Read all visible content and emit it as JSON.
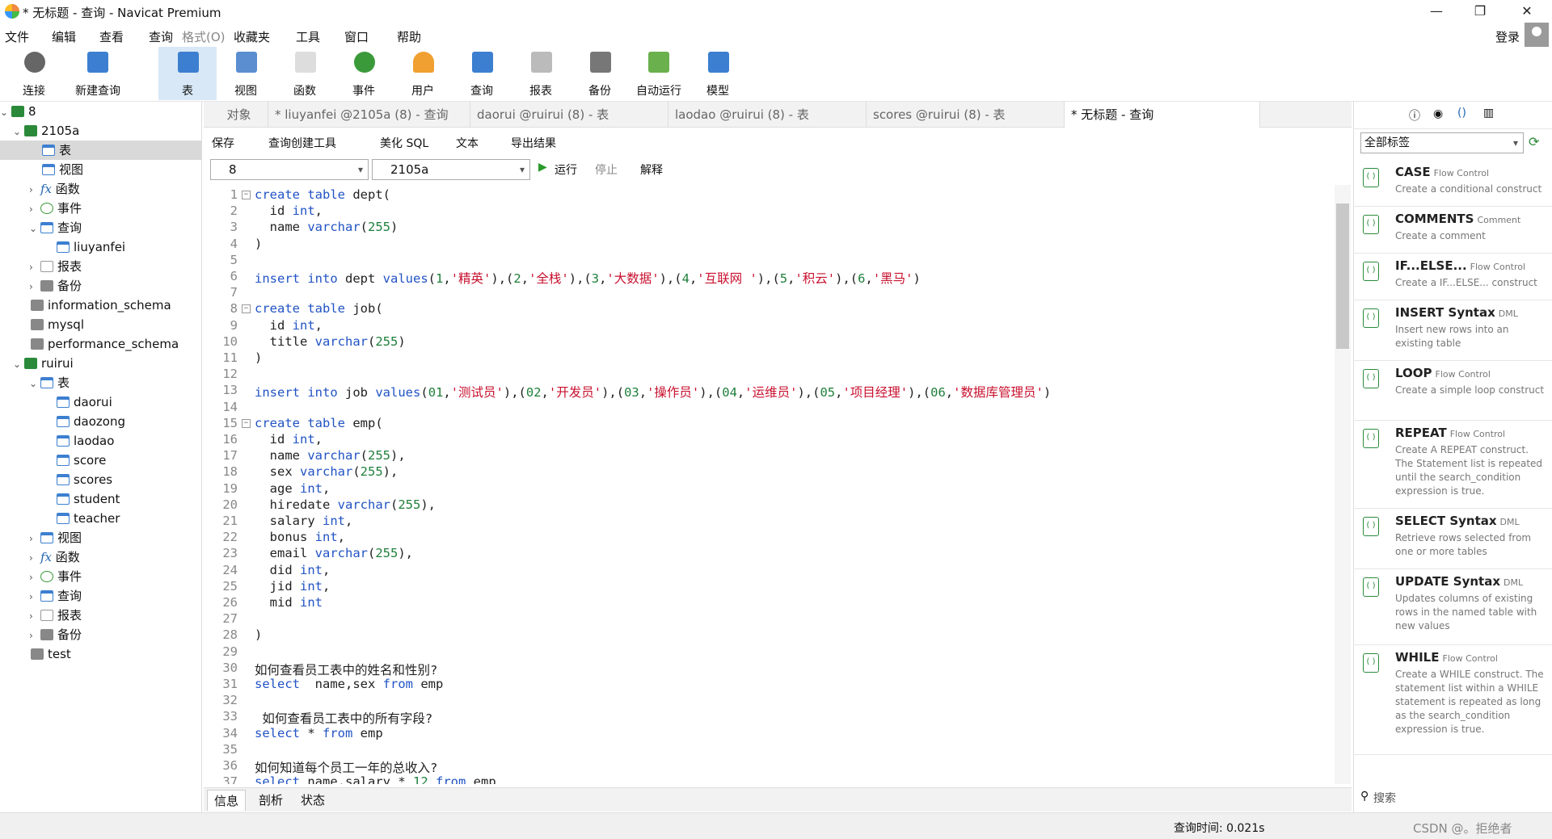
{
  "window": {
    "title": "* 无标题 - 查询 - Navicat Premium",
    "min": "—",
    "max": "❐",
    "close": "✕"
  },
  "menu": [
    "文件",
    "编辑",
    "查看",
    "查询",
    "格式(O)",
    "收藏夹",
    "工具",
    "窗口",
    "帮助"
  ],
  "login": "登录",
  "toolbar": [
    "连接",
    "新建查询",
    "表",
    "视图",
    "函数",
    "事件",
    "用户",
    "查询",
    "报表",
    "备份",
    "自动运行",
    "模型"
  ],
  "tree": {
    "conn": "8",
    "db1": "2105a",
    "n_table": "表",
    "n_view": "视图",
    "n_func": "函数",
    "n_event": "事件",
    "n_query": "查询",
    "q1": "liuyanfei",
    "n_report": "报表",
    "n_backup": "备份",
    "db2": "information_schema",
    "db3": "mysql",
    "db4": "performance_schema",
    "db5": "ruirui",
    "tables": [
      "daorui",
      "daozong",
      "laodao",
      "score",
      "scores",
      "student",
      "teacher"
    ],
    "db6": "test"
  },
  "tabs": [
    "对象",
    "* liuyanfei @2105a (8) - 查询",
    "daorui @ruirui (8) - 表",
    "laodao @ruirui (8) - 表",
    "scores @ruirui (8) - 表",
    "* 无标题 - 查询"
  ],
  "qbar": {
    "save": "保存",
    "builder": "查询创建工具",
    "beautify": "美化 SQL",
    "text": "文本",
    "export": "导出结果"
  },
  "selbar": {
    "conn": "8",
    "db": "2105a",
    "run": "运行",
    "stop": "停止",
    "explain": "解释"
  },
  "bottom_tabs": [
    "信息",
    "剖析",
    "状态"
  ],
  "status": {
    "time": "查询时间: 0.021s",
    "watermark": "CSDN @。拒绝者"
  },
  "right": {
    "filter": "全部标签",
    "search": "搜索"
  },
  "snippets": [
    {
      "name": "CASE",
      "tag": "Flow Control",
      "desc": "Create a conditional construct"
    },
    {
      "name": "COMMENTS",
      "tag": "Comment",
      "desc": "Create a comment"
    },
    {
      "name": "IF...ELSE...",
      "tag": "Flow Control",
      "desc": "Create a IF...ELSE... construct"
    },
    {
      "name": "INSERT Syntax",
      "tag": "DML",
      "desc": "Insert new rows into an existing table"
    },
    {
      "name": "LOOP",
      "tag": "Flow Control",
      "desc": "Create a simple loop construct"
    },
    {
      "name": "REPEAT",
      "tag": "Flow Control",
      "desc": "Create A REPEAT construct. The Statement list is repeated until the search_condition expression is true."
    },
    {
      "name": "SELECT Syntax",
      "tag": "DML",
      "desc": "Retrieve rows selected from one or more tables"
    },
    {
      "name": "UPDATE Syntax",
      "tag": "DML",
      "desc": "Updates columns of existing rows in the named table with new values"
    },
    {
      "name": "WHILE",
      "tag": "Flow Control",
      "desc": "Create a WHILE construct. The statement list within a WHILE statement is repeated as long as the search_condition expression is true."
    }
  ],
  "code": [
    "create table dept(",
    "  id int,",
    "  name varchar(255)",
    ")",
    "",
    "insert into dept values(1,'精英'),(2,'全栈'),(3,'大数据'),(4,'互联网 '),(5,'积云'),(6,'黑马')",
    "",
    "create table job(",
    "  id int,",
    "  title varchar(255)",
    ")",
    "",
    "insert into job values(01,'测试员'),(02,'开发员'),(03,'操作员'),(04,'运维员'),(05,'项目经理'),(06,'数据库管理员')",
    "",
    "create table emp(",
    "  id int,",
    "  name varchar(255),",
    "  sex varchar(255),",
    "  age int,",
    "  hiredate varchar(255),",
    "  salary int,",
    "  bonus int,",
    "  email varchar(255),",
    "  did int,",
    "  jid int,",
    "  mid int",
    "",
    ")",
    "",
    "如何查看员工表中的姓名和性别?",
    "select  name,sex from emp",
    "",
    " 如何查看员工表中的所有字段?",
    "select * from emp",
    "",
    "如何知道每个员工一年的总收入?",
    "select name,salary * 12 from emp"
  ]
}
